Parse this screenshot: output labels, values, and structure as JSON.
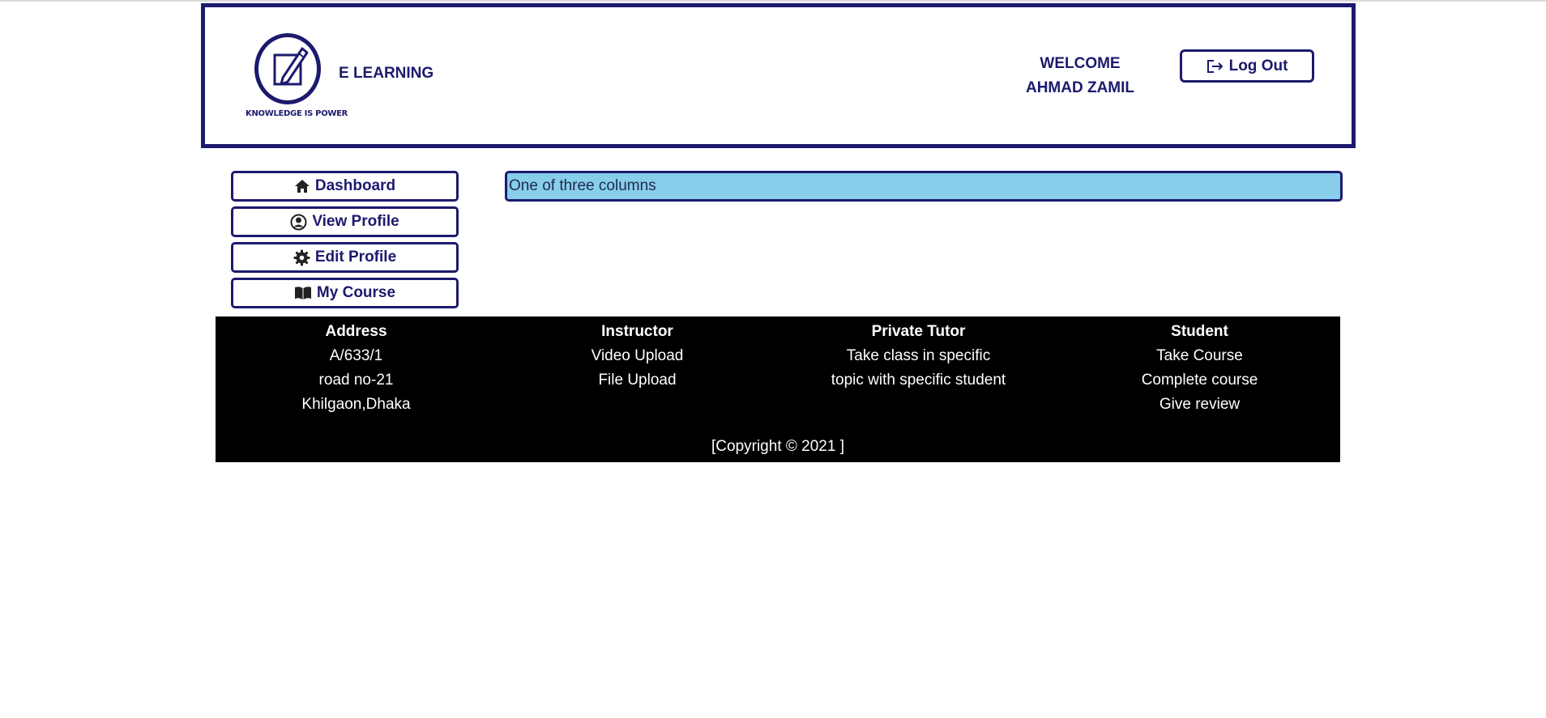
{
  "header": {
    "logo_tagline": "KNOWLEDGE IS POWER",
    "brand": "E LEARNING",
    "welcome_line1": "WELCOME",
    "welcome_line2": "AHMAD ZAMIL",
    "logout_label": "Log Out",
    "logout_icon": "log-out-icon"
  },
  "sidebar": {
    "items": [
      {
        "label": "Dashboard",
        "icon": "home-icon"
      },
      {
        "label": "View Profile",
        "icon": "user-circle-icon"
      },
      {
        "label": "Edit Profile",
        "icon": "gear-icon"
      },
      {
        "label": "My Course",
        "icon": "book-icon"
      }
    ]
  },
  "main": {
    "column_text": "One of three columns"
  },
  "footer": {
    "columns": [
      {
        "heading": "Address",
        "lines": [
          "A/633/1",
          "road no-21",
          "Khilgaon,Dhaka"
        ]
      },
      {
        "heading": "Instructor",
        "lines": [
          "Video Upload",
          "File Upload"
        ]
      },
      {
        "heading": "Private Tutor",
        "lines": [
          "Take class in specific",
          "topic with specific student"
        ]
      },
      {
        "heading": "Student",
        "lines": [
          "Take Course",
          "Complete course",
          "Give review"
        ]
      }
    ],
    "copyright": "[Copyright © 2021 ]"
  },
  "colors": {
    "brand": "#1c1a6e",
    "column_bg": "#87ceeb",
    "footer_bg": "#000000"
  }
}
